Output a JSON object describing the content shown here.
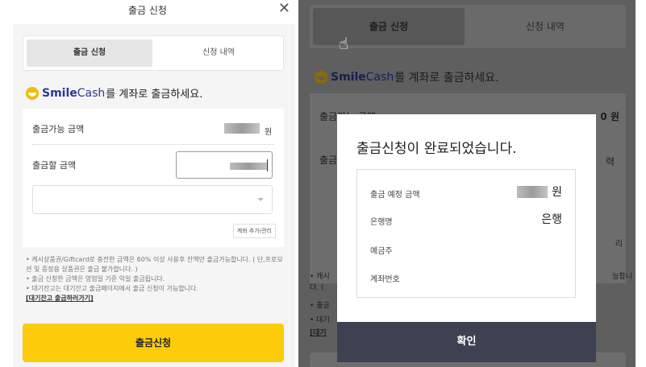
{
  "left": {
    "header": {
      "title": "출금 신청",
      "close_icon": "close-icon"
    },
    "tabs": [
      {
        "label": "출금 신청",
        "active": true
      },
      {
        "label": "신청 내역",
        "active": false
      }
    ],
    "intro": {
      "brand_smile": "Smile",
      "brand_cash": "Cash",
      "text": "를 계좌로 출금하세요."
    },
    "available": {
      "label": "출금가능 금액",
      "unit": "원"
    },
    "withdraw": {
      "label": "출금할 금액"
    },
    "account_select": {
      "value": ""
    },
    "manage_button": "계좌 추가/관리",
    "notes": [
      "• 캐시상품권/Giftcard로 충전한 금액은 60% 이상 사용후 잔액만 출금가능합니다. ( 단,프로모션 및 증정용 상품권은 출금 불가합니다. )",
      "• 출금 신청한 금액은 영업일 기준 익일 출금됩니다.",
      "• 대기잔고는 대기잔고 출금페이지에서 출금 신청이 가능합니다."
    ],
    "notes_link": "[대기잔고 출금하러가기]",
    "submit_button": "출금신청"
  },
  "right": {
    "tabs": [
      {
        "label": "출금 신청",
        "active": true
      },
      {
        "label": "신청 내역",
        "active": false
      }
    ],
    "intro": {
      "brand_smile": "Smile",
      "brand_cash": "Cash",
      "text": "를 계좌로 출금하세요."
    },
    "background_fragments": {
      "available_label": "출금가능 금액",
      "available_value": "0 원",
      "withdraw_label": "출금",
      "right_edge_1": "력",
      "right_edge_2": "리",
      "note_left_1": "• 캐시",
      "note_left_2": "다. (",
      "note_left_3": "• 출금",
      "note_left_4": "• 대기",
      "note_left_5": "[대기",
      "note_right": "능합니"
    },
    "modal": {
      "title": "출금신청이 완료되었습니다.",
      "rows": [
        {
          "label": "출금 예정 금액",
          "value": "원"
        },
        {
          "label": "은행명",
          "value": "은행"
        },
        {
          "label": "예금주",
          "value": ""
        },
        {
          "label": "계좌번호",
          "value": ""
        }
      ],
      "confirm_button": "확인"
    }
  },
  "colors": {
    "accent_yellow": "#fccc0b",
    "brand_blue": "#2b3990",
    "modal_button": "#3d4152",
    "overlay": "#5f5f5f"
  }
}
